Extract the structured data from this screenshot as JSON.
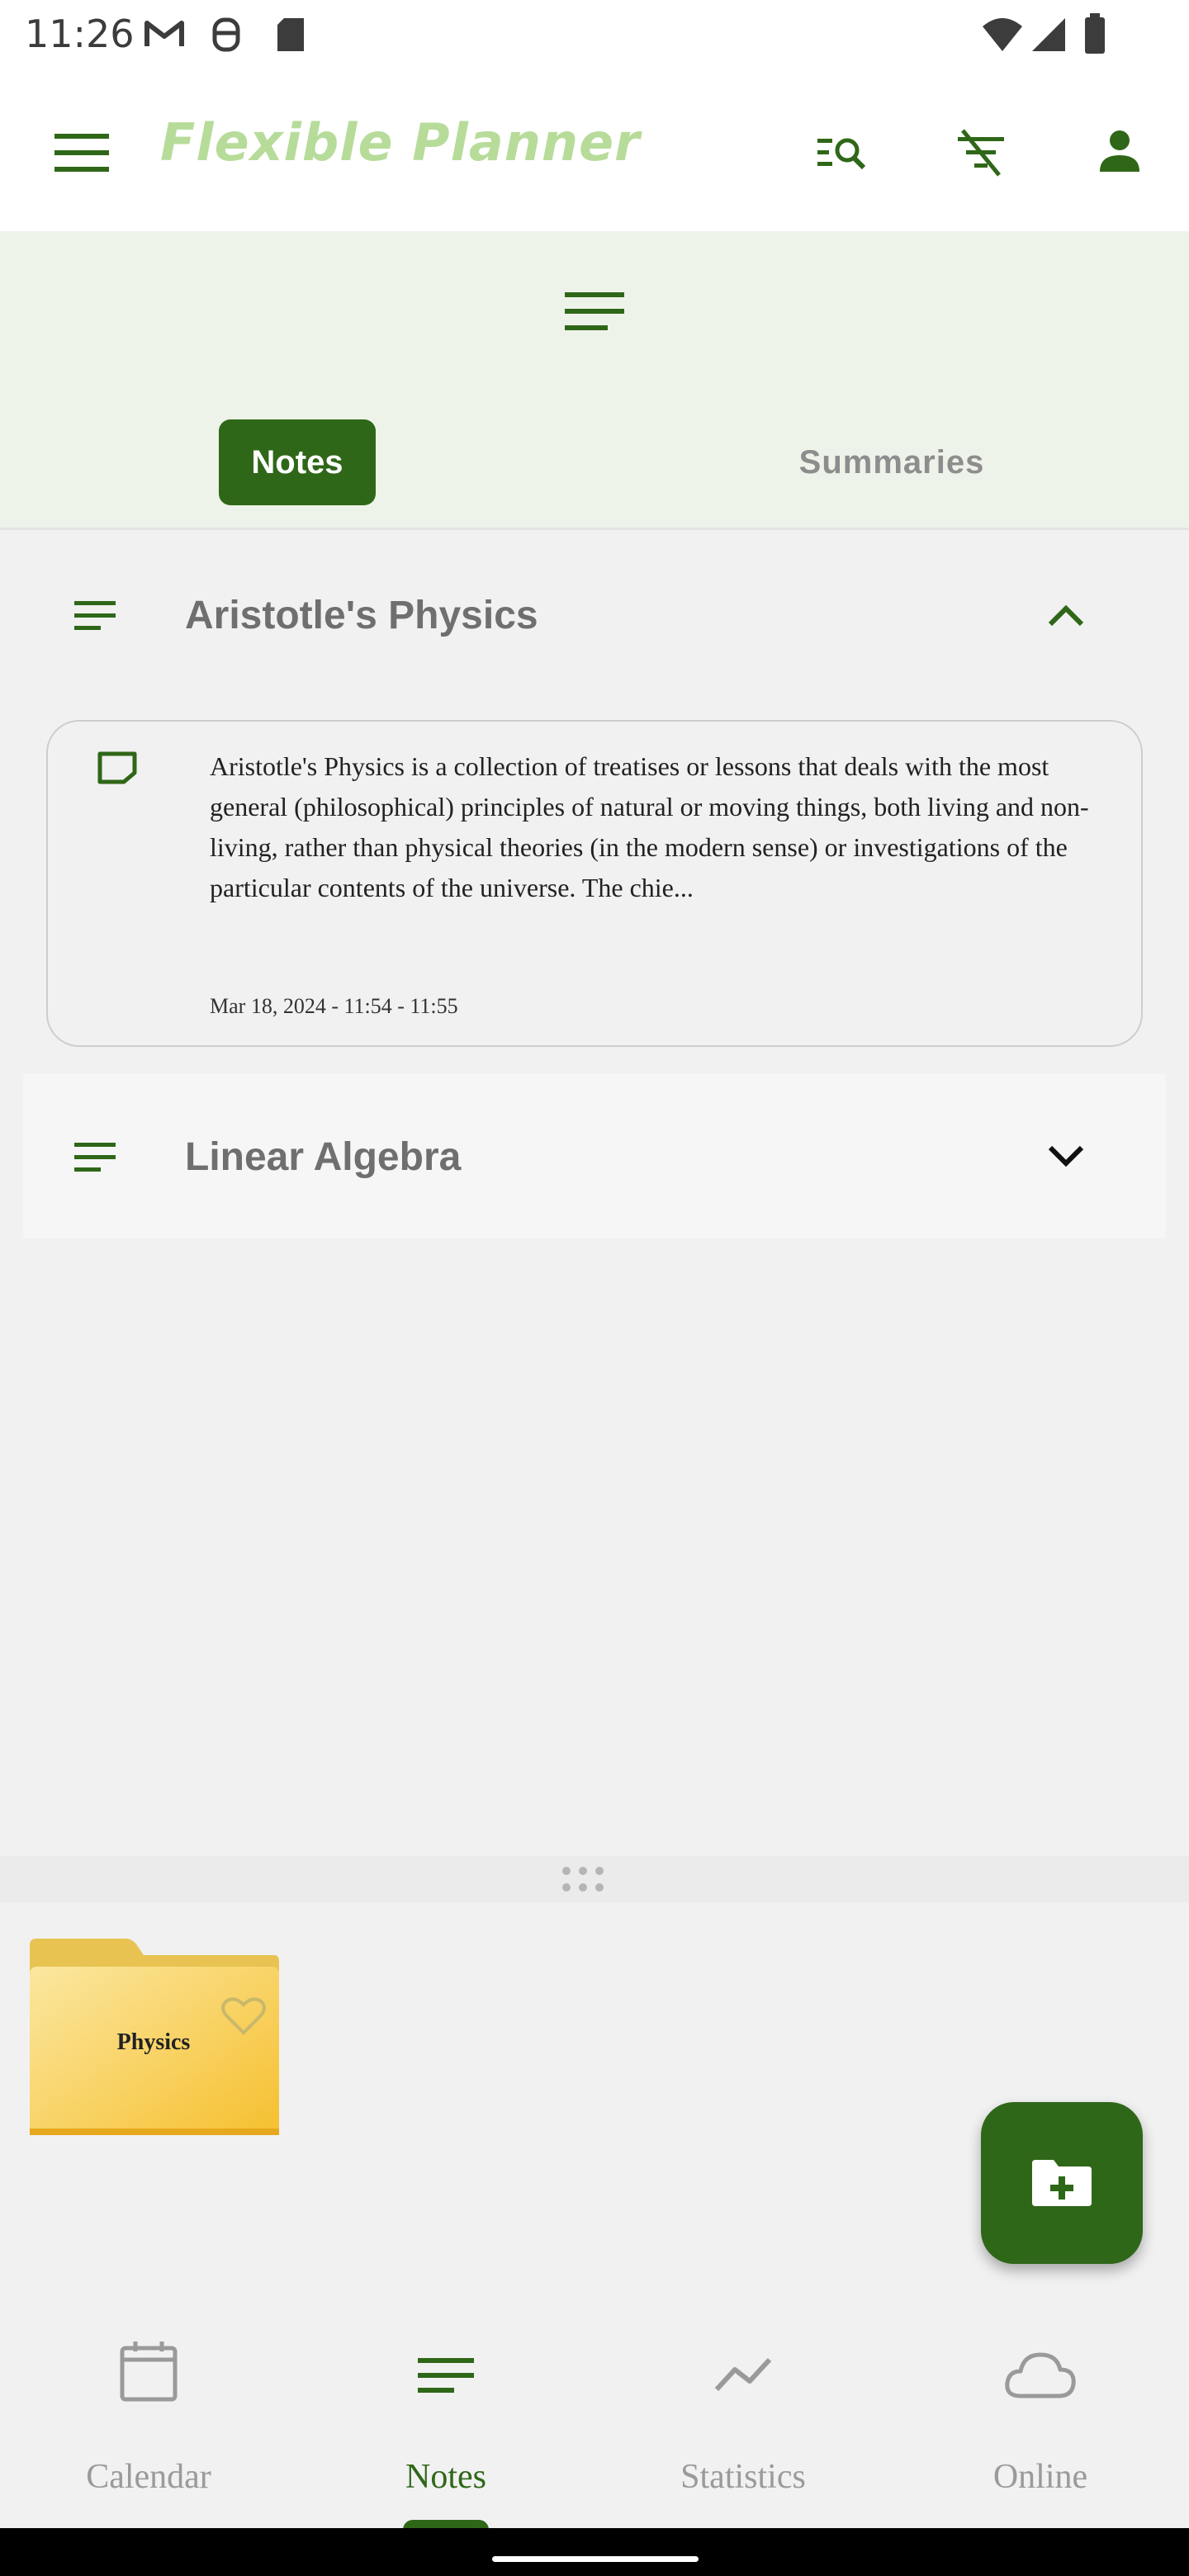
{
  "status_bar": {
    "time": "11:26"
  },
  "app_bar": {
    "title": "Flexible Planner"
  },
  "tabs": [
    {
      "label": "Notes",
      "active": true
    },
    {
      "label": "Summaries",
      "active": false
    }
  ],
  "groups": [
    {
      "title": "Aristotle's Physics",
      "expanded": true,
      "notes": [
        {
          "text": "Aristotle's Physics  is a collection of treatises or lessons that deals with the most general (philosophical) principles of natural or moving things, both living and non-living, rather than physical theories (in the modern sense) or investigations of the particular contents of the universe. The chie...",
          "date": "Mar 18, 2024 - 11:54 - 11:55"
        }
      ]
    },
    {
      "title": "Linear Algebra",
      "expanded": false
    }
  ],
  "folders": [
    {
      "name": "Physics"
    }
  ],
  "bottom_nav": [
    {
      "label": "Calendar",
      "icon": "calendar-icon",
      "active": false
    },
    {
      "label": "Notes",
      "icon": "notes-icon",
      "active": true
    },
    {
      "label": "Statistics",
      "icon": "statistics-icon",
      "active": false
    },
    {
      "label": "Online",
      "icon": "cloud-icon",
      "active": false
    }
  ],
  "colors": {
    "primary": "#2f6718",
    "title": "#b7dc9a",
    "inactive": "#9a9a9a"
  }
}
